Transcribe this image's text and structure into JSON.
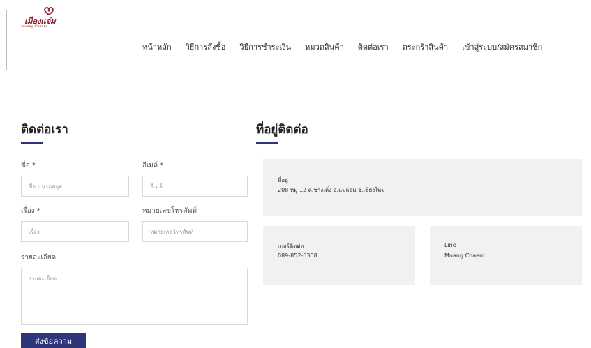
{
  "brand": {
    "name": "เมืองแจ่ม",
    "tagline": "Muang Chaem"
  },
  "nav": {
    "items": [
      {
        "label": "หน้าหลัก"
      },
      {
        "label": "วิธีการสั่งซื้อ"
      },
      {
        "label": "วิธีการชำระเงิน"
      },
      {
        "label": "หมวดสินค้า"
      },
      {
        "label": "ติดต่อเรา"
      },
      {
        "label": "ตระกร้าสินค้า"
      },
      {
        "label": "เข้าสู่ระบบ/สมัครสมาชิก"
      }
    ]
  },
  "contact_form": {
    "title": "ติดต่อเรา",
    "name": {
      "label": "ชื่อ *",
      "placeholder": "ชื่อ - นามสกุล"
    },
    "email": {
      "label": "อีเมล์ *",
      "placeholder": "อีเมล์"
    },
    "subject": {
      "label": "เรื่อง *",
      "placeholder": "เรื่อง"
    },
    "phone": {
      "label": "หมายเลขโทรศัพท์",
      "placeholder": "หมายเลขโทรศัพท์"
    },
    "details": {
      "label": "รายละเอียด",
      "placeholder": "รายละเอียด"
    },
    "submit_label": "ส่งข้อความ"
  },
  "contact_info": {
    "title": "ที่อยู่ติดต่อ",
    "address": {
      "label": "ที่อยู่",
      "value": "208 หมู่ 12 ต.ช่างเคิ่ง อ.แม่แจ่ม จ.เชียงใหม่"
    },
    "phone": {
      "label": "เบอร์ติดต่อ",
      "value": "089-852-5308"
    },
    "line": {
      "label": "Line",
      "value": "Muang Chaem"
    }
  },
  "colors": {
    "accent": "#2e3579",
    "brand": "#8d1d2c",
    "card": "#f1f1f1"
  }
}
